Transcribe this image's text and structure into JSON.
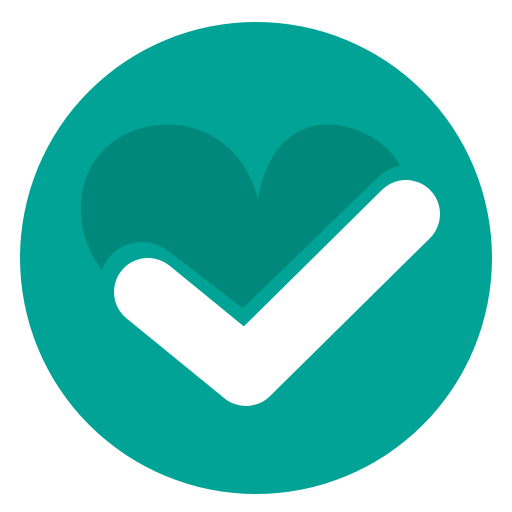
{
  "icon": {
    "name": "heart-checkmark-icon",
    "colors": {
      "background": "#ffffff",
      "circle": "#00A396",
      "heart": "#00887C",
      "check": "#ffffff"
    }
  }
}
